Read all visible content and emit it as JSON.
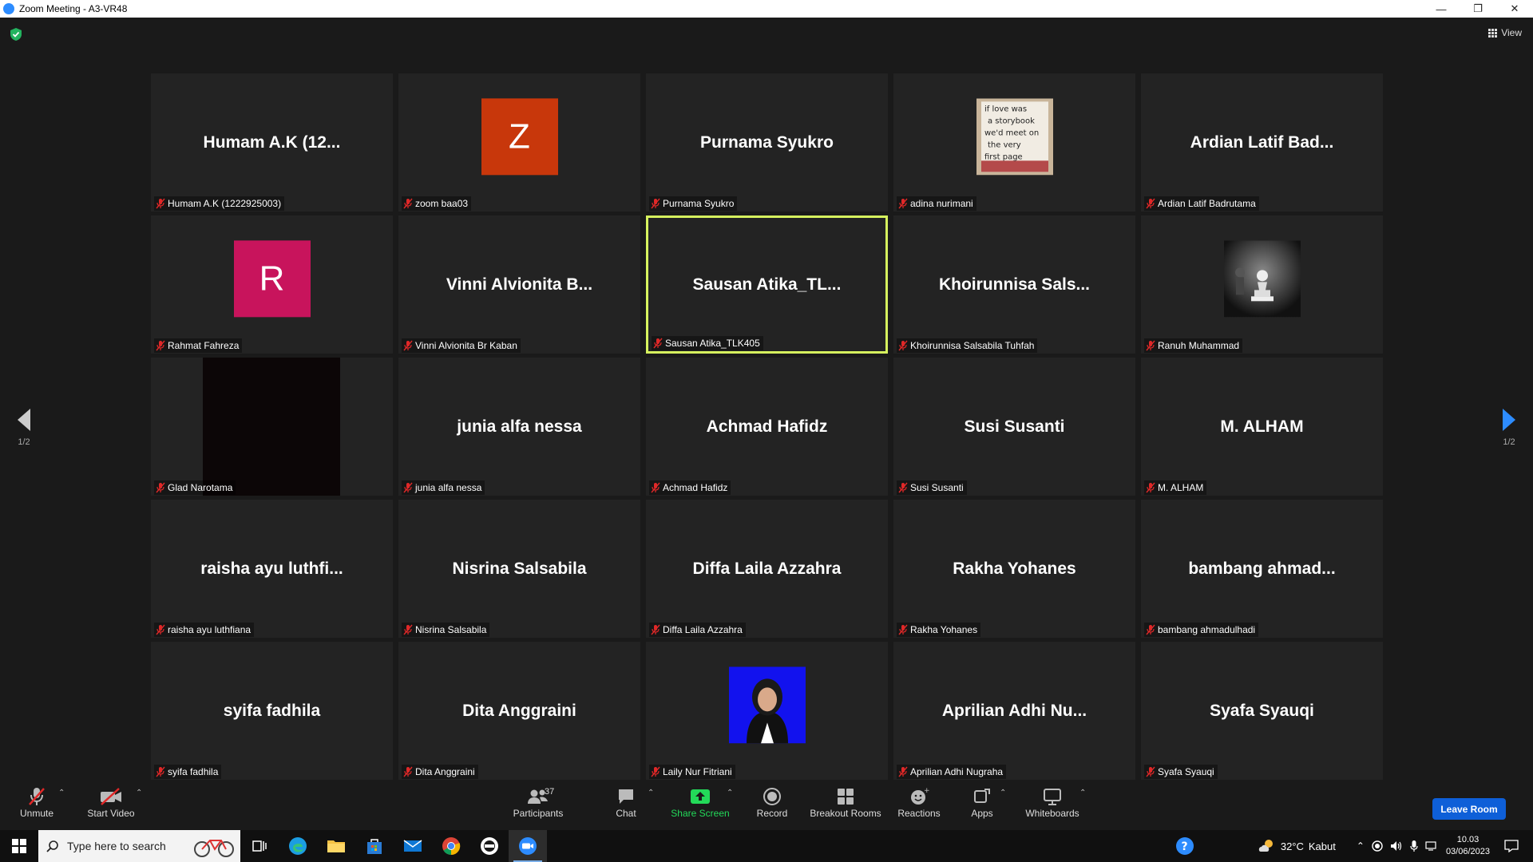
{
  "window": {
    "title": "Zoom Meeting - A3-VR48"
  },
  "view_label": "View",
  "pager": {
    "left": "1/2",
    "right": "1/2"
  },
  "tiles": [
    {
      "display": "Humam A.K (12...",
      "name": "Humam A.K (1222925003)",
      "type": "text"
    },
    {
      "display": "Z",
      "name": "zoom baa03",
      "type": "letter",
      "color": "#c8370b"
    },
    {
      "display": "Purnama Syukro",
      "name": "Purnama Syukro",
      "type": "text"
    },
    {
      "display": "",
      "name": "adina nurimani",
      "type": "image-storybook"
    },
    {
      "display": "Ardian Latif Bad...",
      "name": "Ardian Latif Badrutama",
      "type": "text"
    },
    {
      "display": "R",
      "name": "Rahmat Fahreza",
      "type": "letter",
      "color": "#c8145c"
    },
    {
      "display": "Vinni Alvionita B...",
      "name": "Vinni Alvionita Br Kaban",
      "type": "text"
    },
    {
      "display": "Sausan Atika_TL...",
      "name": "Sausan Atika_TLK405",
      "type": "text",
      "active": true
    },
    {
      "display": "Khoirunnisa Sals...",
      "name": "Khoirunnisa Salsabila Tuhfah",
      "type": "text"
    },
    {
      "display": "",
      "name": "Ranuh Muhammad",
      "type": "image-chess"
    },
    {
      "display": "",
      "name": "Glad Narotama",
      "type": "dark-video"
    },
    {
      "display": "junia alfa nessa",
      "name": "junia alfa nessa",
      "type": "text"
    },
    {
      "display": "Achmad Hafidz",
      "name": "Achmad Hafidz",
      "type": "text"
    },
    {
      "display": "Susi Susanti",
      "name": "Susi Susanti",
      "type": "text"
    },
    {
      "display": "M. ALHAM",
      "name": "M. ALHAM",
      "type": "text"
    },
    {
      "display": "raisha ayu luthfi...",
      "name": "raisha ayu luthfiana",
      "type": "text"
    },
    {
      "display": "Nisrina Salsabila",
      "name": "Nisrina Salsabila",
      "type": "text"
    },
    {
      "display": "Diffa Laila Azzahra",
      "name": "Diffa Laila Azzahra",
      "type": "text"
    },
    {
      "display": "Rakha Yohanes",
      "name": "Rakha Yohanes",
      "type": "text"
    },
    {
      "display": "bambang ahmad...",
      "name": "bambang ahmadulhadi",
      "type": "text"
    },
    {
      "display": "syifa fadhila",
      "name": "syifa fadhila",
      "type": "text"
    },
    {
      "display": "Dita Anggraini",
      "name": "Dita Anggraini",
      "type": "text"
    },
    {
      "display": "",
      "name": "Laily Nur Fitriani",
      "type": "image-portrait"
    },
    {
      "display": "Aprilian Adhi Nu...",
      "name": "Aprilian Adhi Nugraha",
      "type": "text"
    },
    {
      "display": "Syafa Syauqi",
      "name": "Syafa Syauqi",
      "type": "text"
    }
  ],
  "storybook_lines": [
    "if love was",
    "a storybook",
    "we'd meet on",
    "the very",
    "first page"
  ],
  "toolbar": {
    "unmute": "Unmute",
    "start_video": "Start Video",
    "participants": "Participants",
    "participants_count": "37",
    "chat": "Chat",
    "share_screen": "Share Screen",
    "record": "Record",
    "breakout_rooms": "Breakout Rooms",
    "reactions": "Reactions",
    "apps": "Apps",
    "whiteboards": "Whiteboards",
    "leave": "Leave Room"
  },
  "taskbar": {
    "search_placeholder": "Type here to search",
    "weather_temp": "32°C",
    "weather_text": "Kabut",
    "time": "10.03",
    "date": "03/06/2023"
  },
  "colors": {
    "accent": "#2d8cff",
    "active_speaker": "#d6f25e",
    "share_green": "#23d959",
    "leave": "#0e5fd8",
    "muted_red": "#e02828"
  }
}
